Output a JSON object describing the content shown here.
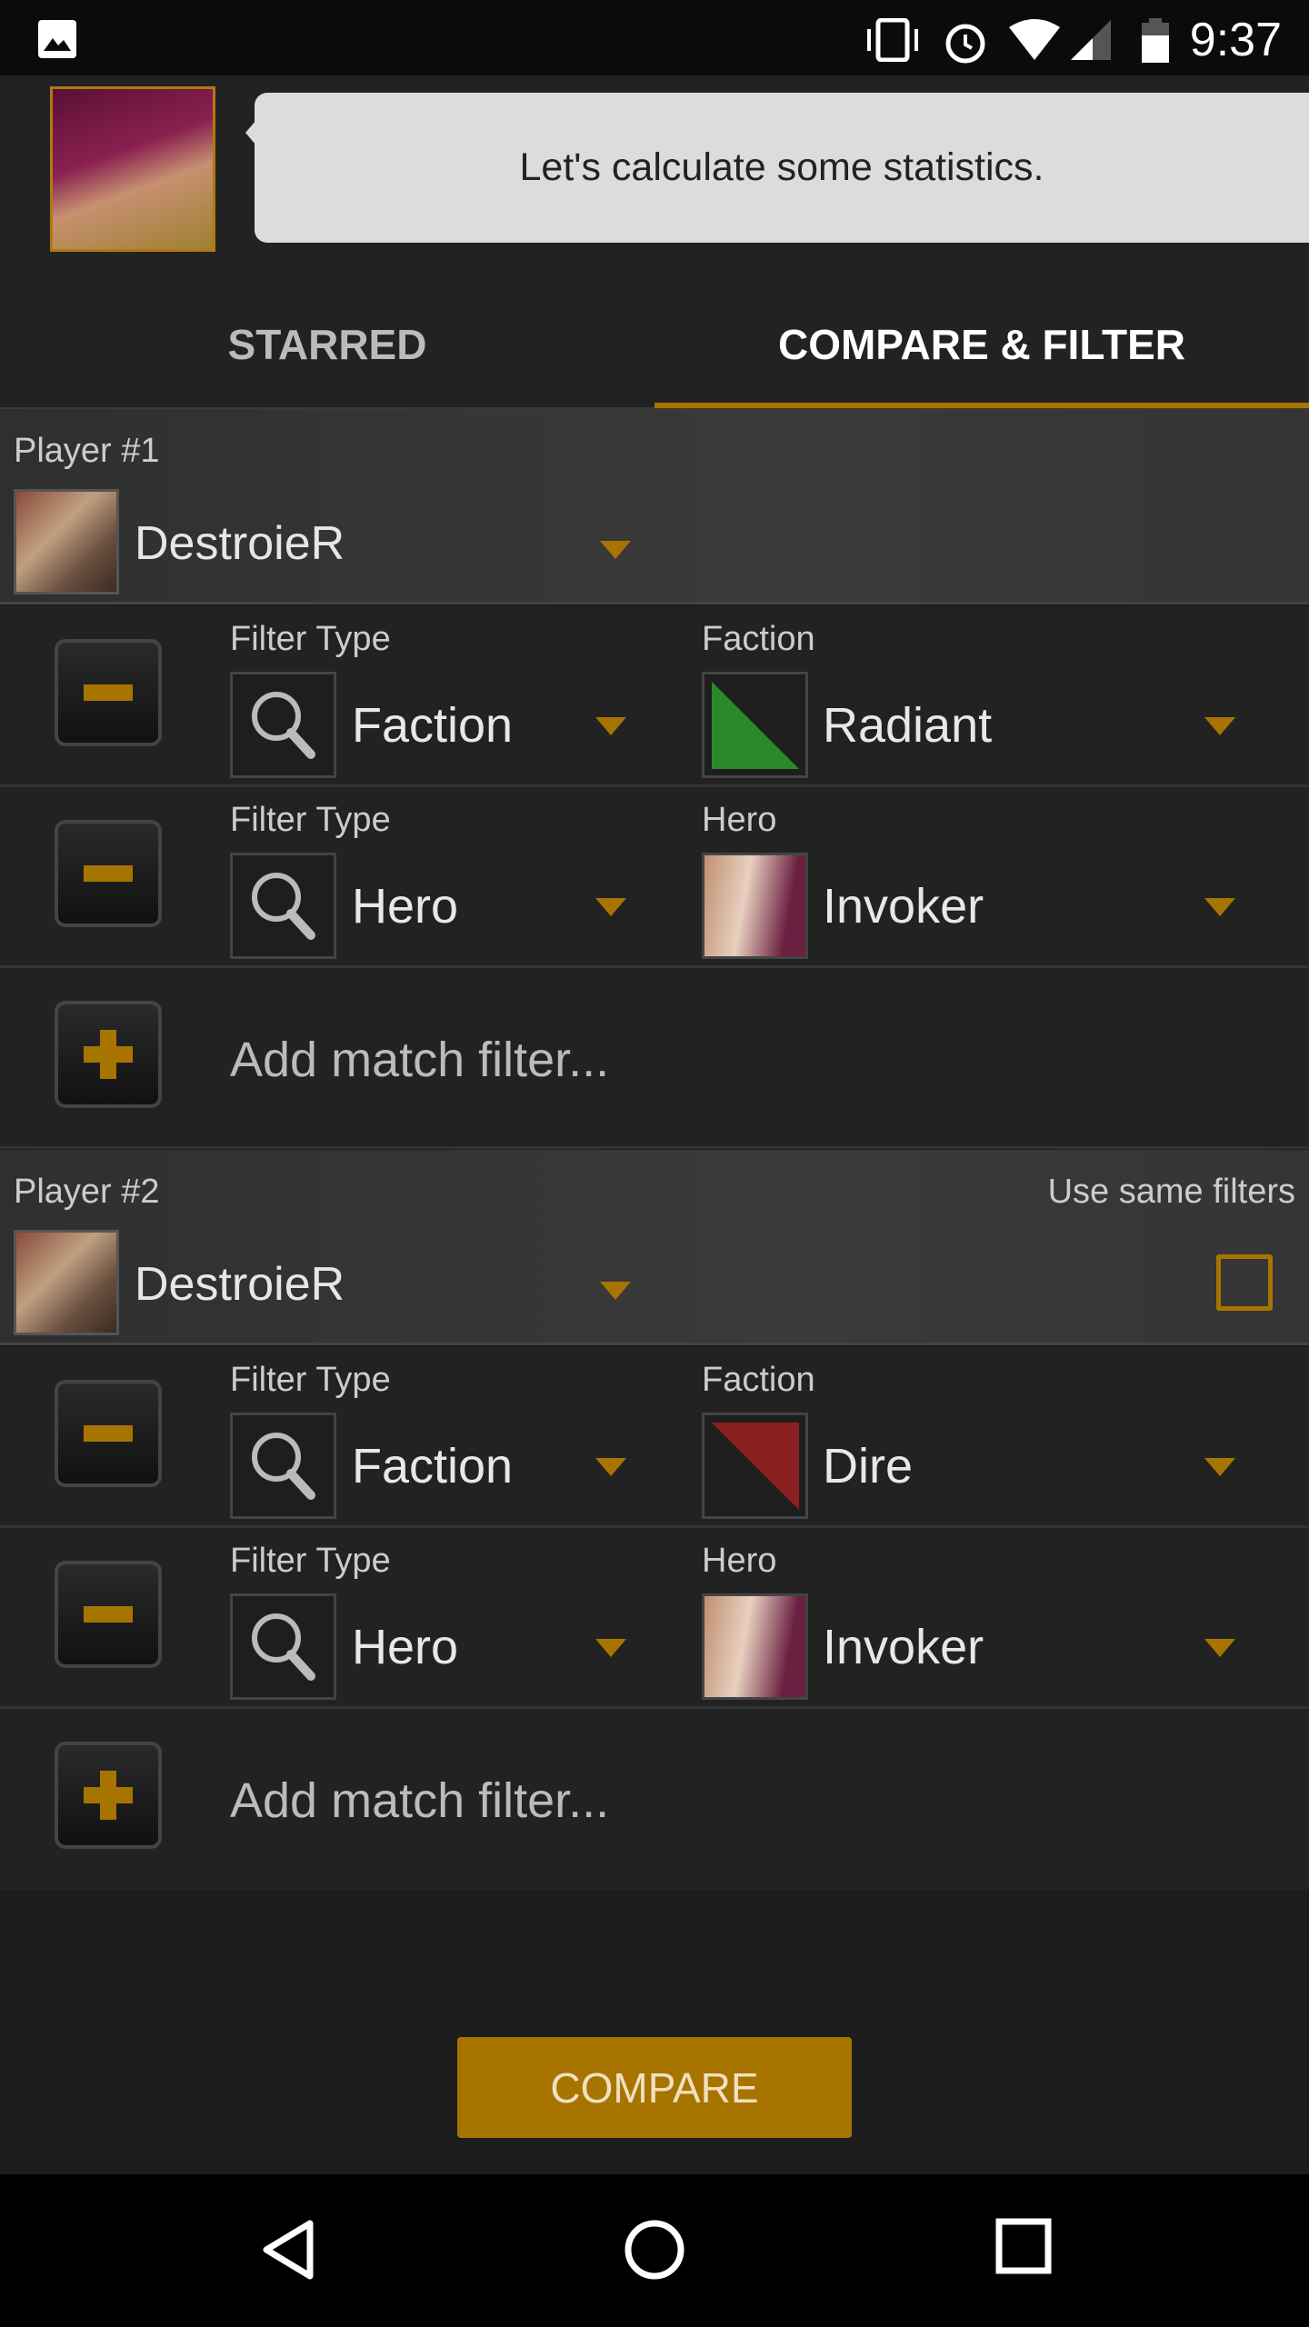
{
  "status_bar": {
    "time": "9:37",
    "icons": [
      "image-icon",
      "vibrate-icon",
      "alarm-icon",
      "wifi-icon",
      "signal-icon",
      "battery-icon"
    ]
  },
  "bubble": {
    "message": "Let's calculate some statistics."
  },
  "tabs": [
    {
      "label": "STARRED",
      "active": false
    },
    {
      "label": "COMPARE & FILTER",
      "active": true
    }
  ],
  "players": [
    {
      "label": "Player #1",
      "name": "DestroieR",
      "filters": [
        {
          "type_label": "Filter Type",
          "type_value": "Faction",
          "value_label": "Faction",
          "value": "Radiant",
          "value_icon": "radiant-icon"
        },
        {
          "type_label": "Filter Type",
          "type_value": "Hero",
          "value_label": "Hero",
          "value": "Invoker",
          "value_icon": "invoker-portrait"
        }
      ],
      "add_label": "Add match filter..."
    },
    {
      "label": "Player #2",
      "name": "DestroieR",
      "use_same_label": "Use same filters",
      "use_same_checked": false,
      "filters": [
        {
          "type_label": "Filter Type",
          "type_value": "Faction",
          "value_label": "Faction",
          "value": "Dire",
          "value_icon": "dire-icon"
        },
        {
          "type_label": "Filter Type",
          "type_value": "Hero",
          "value_label": "Hero",
          "value": "Invoker",
          "value_icon": "invoker-portrait"
        }
      ],
      "add_label": "Add match filter..."
    }
  ],
  "compare_label": "COMPARE",
  "colors": {
    "accent": "#a87400",
    "radiant": "#2a8a2a",
    "dire": "#8a2020",
    "bubble": "#dcdcdc"
  }
}
